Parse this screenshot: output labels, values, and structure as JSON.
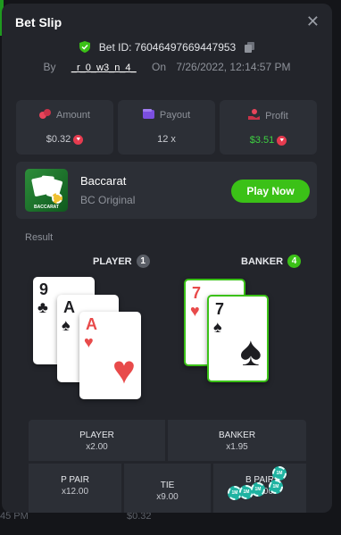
{
  "dialog": {
    "title": "Bet Slip",
    "bet_id": "Bet ID: 76046497669447953",
    "by_label": "By",
    "username": "_r_0_w3_n_4_",
    "on_label": "On",
    "timestamp": "7/26/2022, 12:14:57 PM"
  },
  "stats": {
    "amount_label": "Amount",
    "amount_value": "$0.32",
    "payout_label": "Payout",
    "payout_value": "12 x",
    "profit_label": "Profit",
    "profit_value": "$3.51"
  },
  "game": {
    "name": "Baccarat",
    "subtitle": "BC Original",
    "play_label": "Play Now",
    "thumb_text": "BACCARAT"
  },
  "result": {
    "label": "Result",
    "player_label": "PLAYER",
    "player_count": "1",
    "banker_label": "BANKER",
    "banker_count": "4",
    "player_cards": [
      {
        "rank": "9",
        "suit": "♣",
        "color": "black"
      },
      {
        "rank": "A",
        "suit": "♠",
        "color": "black"
      },
      {
        "rank": "A",
        "suit": "♥",
        "color": "red"
      }
    ],
    "banker_cards": [
      {
        "rank": "7",
        "suit": "♥",
        "color": "red"
      },
      {
        "rank": "7",
        "suit": "♠",
        "color": "black"
      }
    ]
  },
  "bets": {
    "player": {
      "label": "PLAYER",
      "mult": "x2.00"
    },
    "banker": {
      "label": "BANKER",
      "mult": "x1.95"
    },
    "p_pair": {
      "label": "P PAIR",
      "mult": "x12.00"
    },
    "tie": {
      "label": "TIE",
      "mult": "x9.00"
    },
    "b_pair": {
      "label": "B PAIR",
      "mult": "x12.00"
    },
    "chip_label": "1M"
  },
  "background": {
    "row_time": "45 PM",
    "row_amount": "$0.32"
  },
  "colors": {
    "accent_green": "#3bc117",
    "profit_green": "#3ed141",
    "panel": "#23252b",
    "cell": "#2c2f36"
  }
}
